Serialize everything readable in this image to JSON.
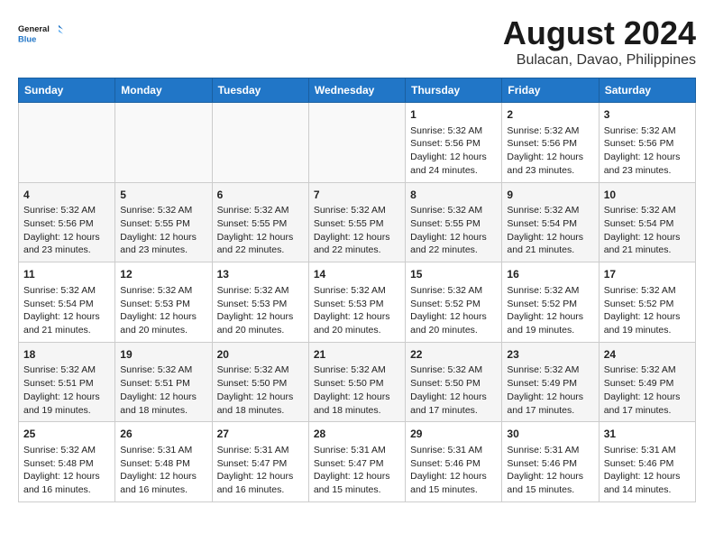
{
  "logo": {
    "line1": "General",
    "line2": "Blue"
  },
  "title": "August 2024",
  "subtitle": "Bulacan, Davao, Philippines",
  "days_of_week": [
    "Sunday",
    "Monday",
    "Tuesday",
    "Wednesday",
    "Thursday",
    "Friday",
    "Saturday"
  ],
  "weeks": [
    [
      {
        "day": "",
        "text": ""
      },
      {
        "day": "",
        "text": ""
      },
      {
        "day": "",
        "text": ""
      },
      {
        "day": "",
        "text": ""
      },
      {
        "day": "1",
        "text": "Sunrise: 5:32 AM\nSunset: 5:56 PM\nDaylight: 12 hours\nand 24 minutes."
      },
      {
        "day": "2",
        "text": "Sunrise: 5:32 AM\nSunset: 5:56 PM\nDaylight: 12 hours\nand 23 minutes."
      },
      {
        "day": "3",
        "text": "Sunrise: 5:32 AM\nSunset: 5:56 PM\nDaylight: 12 hours\nand 23 minutes."
      }
    ],
    [
      {
        "day": "4",
        "text": "Sunrise: 5:32 AM\nSunset: 5:56 PM\nDaylight: 12 hours\nand 23 minutes."
      },
      {
        "day": "5",
        "text": "Sunrise: 5:32 AM\nSunset: 5:55 PM\nDaylight: 12 hours\nand 23 minutes."
      },
      {
        "day": "6",
        "text": "Sunrise: 5:32 AM\nSunset: 5:55 PM\nDaylight: 12 hours\nand 22 minutes."
      },
      {
        "day": "7",
        "text": "Sunrise: 5:32 AM\nSunset: 5:55 PM\nDaylight: 12 hours\nand 22 minutes."
      },
      {
        "day": "8",
        "text": "Sunrise: 5:32 AM\nSunset: 5:55 PM\nDaylight: 12 hours\nand 22 minutes."
      },
      {
        "day": "9",
        "text": "Sunrise: 5:32 AM\nSunset: 5:54 PM\nDaylight: 12 hours\nand 21 minutes."
      },
      {
        "day": "10",
        "text": "Sunrise: 5:32 AM\nSunset: 5:54 PM\nDaylight: 12 hours\nand 21 minutes."
      }
    ],
    [
      {
        "day": "11",
        "text": "Sunrise: 5:32 AM\nSunset: 5:54 PM\nDaylight: 12 hours\nand 21 minutes."
      },
      {
        "day": "12",
        "text": "Sunrise: 5:32 AM\nSunset: 5:53 PM\nDaylight: 12 hours\nand 20 minutes."
      },
      {
        "day": "13",
        "text": "Sunrise: 5:32 AM\nSunset: 5:53 PM\nDaylight: 12 hours\nand 20 minutes."
      },
      {
        "day": "14",
        "text": "Sunrise: 5:32 AM\nSunset: 5:53 PM\nDaylight: 12 hours\nand 20 minutes."
      },
      {
        "day": "15",
        "text": "Sunrise: 5:32 AM\nSunset: 5:52 PM\nDaylight: 12 hours\nand 20 minutes."
      },
      {
        "day": "16",
        "text": "Sunrise: 5:32 AM\nSunset: 5:52 PM\nDaylight: 12 hours\nand 19 minutes."
      },
      {
        "day": "17",
        "text": "Sunrise: 5:32 AM\nSunset: 5:52 PM\nDaylight: 12 hours\nand 19 minutes."
      }
    ],
    [
      {
        "day": "18",
        "text": "Sunrise: 5:32 AM\nSunset: 5:51 PM\nDaylight: 12 hours\nand 19 minutes."
      },
      {
        "day": "19",
        "text": "Sunrise: 5:32 AM\nSunset: 5:51 PM\nDaylight: 12 hours\nand 18 minutes."
      },
      {
        "day": "20",
        "text": "Sunrise: 5:32 AM\nSunset: 5:50 PM\nDaylight: 12 hours\nand 18 minutes."
      },
      {
        "day": "21",
        "text": "Sunrise: 5:32 AM\nSunset: 5:50 PM\nDaylight: 12 hours\nand 18 minutes."
      },
      {
        "day": "22",
        "text": "Sunrise: 5:32 AM\nSunset: 5:50 PM\nDaylight: 12 hours\nand 17 minutes."
      },
      {
        "day": "23",
        "text": "Sunrise: 5:32 AM\nSunset: 5:49 PM\nDaylight: 12 hours\nand 17 minutes."
      },
      {
        "day": "24",
        "text": "Sunrise: 5:32 AM\nSunset: 5:49 PM\nDaylight: 12 hours\nand 17 minutes."
      }
    ],
    [
      {
        "day": "25",
        "text": "Sunrise: 5:32 AM\nSunset: 5:48 PM\nDaylight: 12 hours\nand 16 minutes."
      },
      {
        "day": "26",
        "text": "Sunrise: 5:31 AM\nSunset: 5:48 PM\nDaylight: 12 hours\nand 16 minutes."
      },
      {
        "day": "27",
        "text": "Sunrise: 5:31 AM\nSunset: 5:47 PM\nDaylight: 12 hours\nand 16 minutes."
      },
      {
        "day": "28",
        "text": "Sunrise: 5:31 AM\nSunset: 5:47 PM\nDaylight: 12 hours\nand 15 minutes."
      },
      {
        "day": "29",
        "text": "Sunrise: 5:31 AM\nSunset: 5:46 PM\nDaylight: 12 hours\nand 15 minutes."
      },
      {
        "day": "30",
        "text": "Sunrise: 5:31 AM\nSunset: 5:46 PM\nDaylight: 12 hours\nand 15 minutes."
      },
      {
        "day": "31",
        "text": "Sunrise: 5:31 AM\nSunset: 5:46 PM\nDaylight: 12 hours\nand 14 minutes."
      }
    ]
  ]
}
